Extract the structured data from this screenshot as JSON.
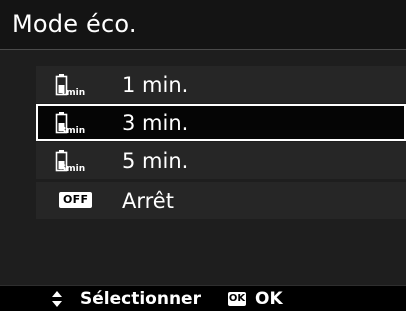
{
  "header": {
    "title": "Mode éco."
  },
  "menu": {
    "items": [
      {
        "label": "1 min.",
        "icon": "battery-timer-1-icon",
        "icon_text": "1min",
        "selected": false
      },
      {
        "label": "3 min.",
        "icon": "battery-timer-3-icon",
        "icon_text": "3min",
        "selected": true
      },
      {
        "label": "5 min.",
        "icon": "battery-timer-5-icon",
        "icon_text": "5min",
        "selected": false
      },
      {
        "label": "Arrêt",
        "icon": "off-badge-icon",
        "icon_text": "OFF",
        "selected": false
      }
    ]
  },
  "footer": {
    "select_icon": "up-down-arrows-icon",
    "select_label": "Sélectionner",
    "ok_badge": "OK",
    "ok_label": "OK"
  },
  "colors": {
    "background": "#000000",
    "list_background": "#1e1e1e",
    "row_background": "#262626",
    "selection_border": "#ffffff",
    "text": "#ffffff"
  }
}
